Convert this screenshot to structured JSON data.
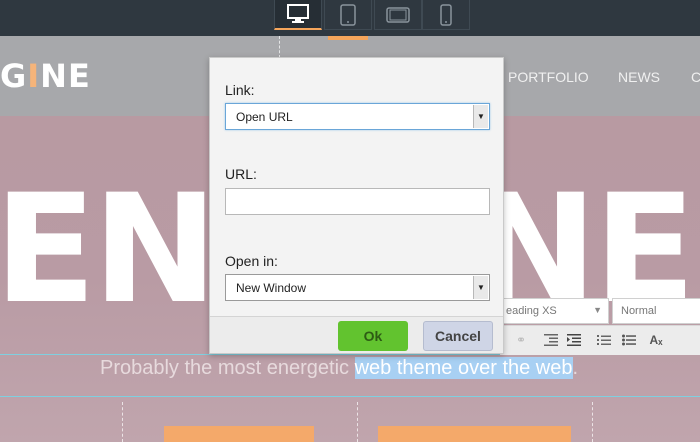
{
  "device_toolbar": {
    "devices": [
      {
        "name": "desktop",
        "icon": "desktop-icon",
        "active": true
      },
      {
        "name": "tablet-portrait",
        "icon": "tablet-portrait-icon",
        "active": false
      },
      {
        "name": "tablet-landscape",
        "icon": "tablet-landscape-icon",
        "active": false
      },
      {
        "name": "phone",
        "icon": "phone-icon",
        "active": false
      }
    ]
  },
  "site": {
    "logo_prefix": "G",
    "logo_accent": "I",
    "logo_suffix": "NE",
    "nav": [
      "PORTFOLIO",
      "NEWS",
      "C"
    ],
    "hero_left": "EN",
    "hero_right": "NE",
    "tagline_plain": "Probably the most energetic ",
    "tagline_selected": "web theme over the web",
    "tagline_end": "."
  },
  "rte": {
    "heading_select": "eading XS",
    "size_select": "Normal",
    "icons": [
      "unlink-icon",
      "outdent-icon",
      "indent-icon",
      "numbered-list-icon",
      "bulleted-list-icon",
      "clear-format-icon"
    ]
  },
  "dialog": {
    "link_label": "Link:",
    "link_value": "Open URL",
    "url_label": "URL:",
    "url_value": "",
    "open_in_label": "Open in:",
    "open_in_value": "New Window",
    "ok_label": "Ok",
    "cancel_label": "Cancel"
  },
  "colors": {
    "accent": "#f5a55b",
    "ok_button": "#62c32f",
    "cancel_button": "#cfd5e6",
    "selection": "#a8d0f3"
  }
}
